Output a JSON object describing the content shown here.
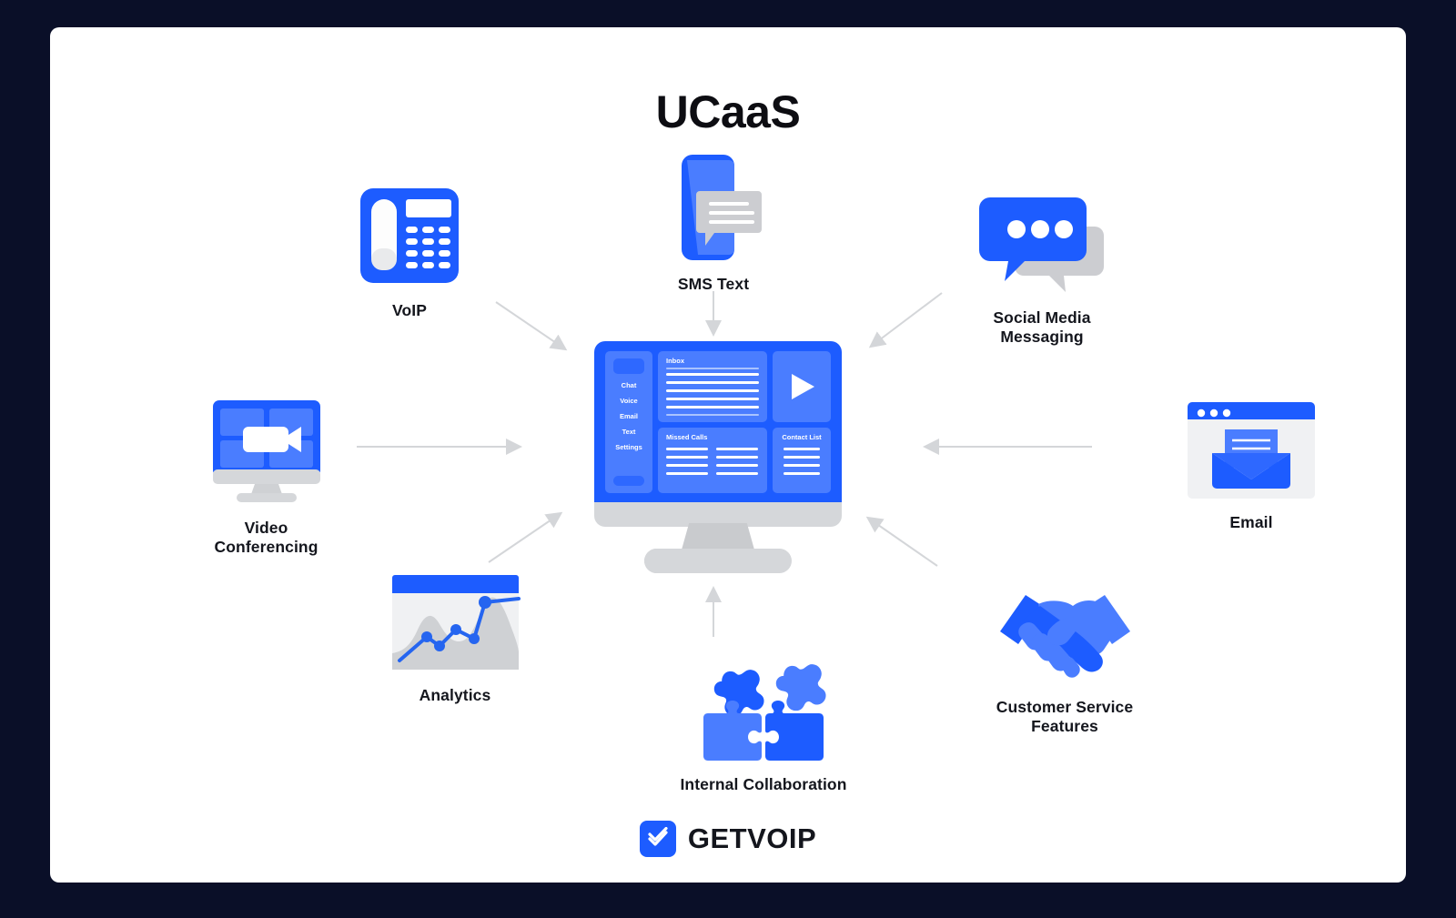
{
  "page": {
    "background_color": "#0a0f28",
    "card_color": "#ffffff",
    "accent_blue": "#1d5cff",
    "accent_blue_light": "#4a7dff",
    "gray": "#d5d7da",
    "title": "UCaaS"
  },
  "center": {
    "name": "ucaas-platform-monitor",
    "sidebar": [
      "Chat",
      "Voice",
      "Email",
      "Text",
      "Settings"
    ],
    "panels": {
      "inbox": "Inbox",
      "missed_calls": "Missed Calls",
      "contact_list": "Contact List",
      "video": "play-button"
    }
  },
  "nodes": [
    {
      "id": "voip",
      "label": "VoIP",
      "icon": "desk-phone-icon"
    },
    {
      "id": "sms",
      "label": "SMS Text",
      "icon": "sms-phone-icon"
    },
    {
      "id": "social",
      "label": "Social Media\nMessaging",
      "icon": "chat-bubbles-icon"
    },
    {
      "id": "email",
      "label": "Email",
      "icon": "envelope-window-icon"
    },
    {
      "id": "customer",
      "label": "Customer Service\nFeatures",
      "icon": "handshake-icon"
    },
    {
      "id": "collab",
      "label": "Internal Collaboration",
      "icon": "puzzle-pieces-icon"
    },
    {
      "id": "analytics",
      "label": "Analytics",
      "icon": "line-chart-icon"
    },
    {
      "id": "video",
      "label": "Video\nConferencing",
      "icon": "video-monitor-icon"
    }
  ],
  "footer": {
    "brand": "GETVOIP",
    "mark": "double-check-icon"
  }
}
